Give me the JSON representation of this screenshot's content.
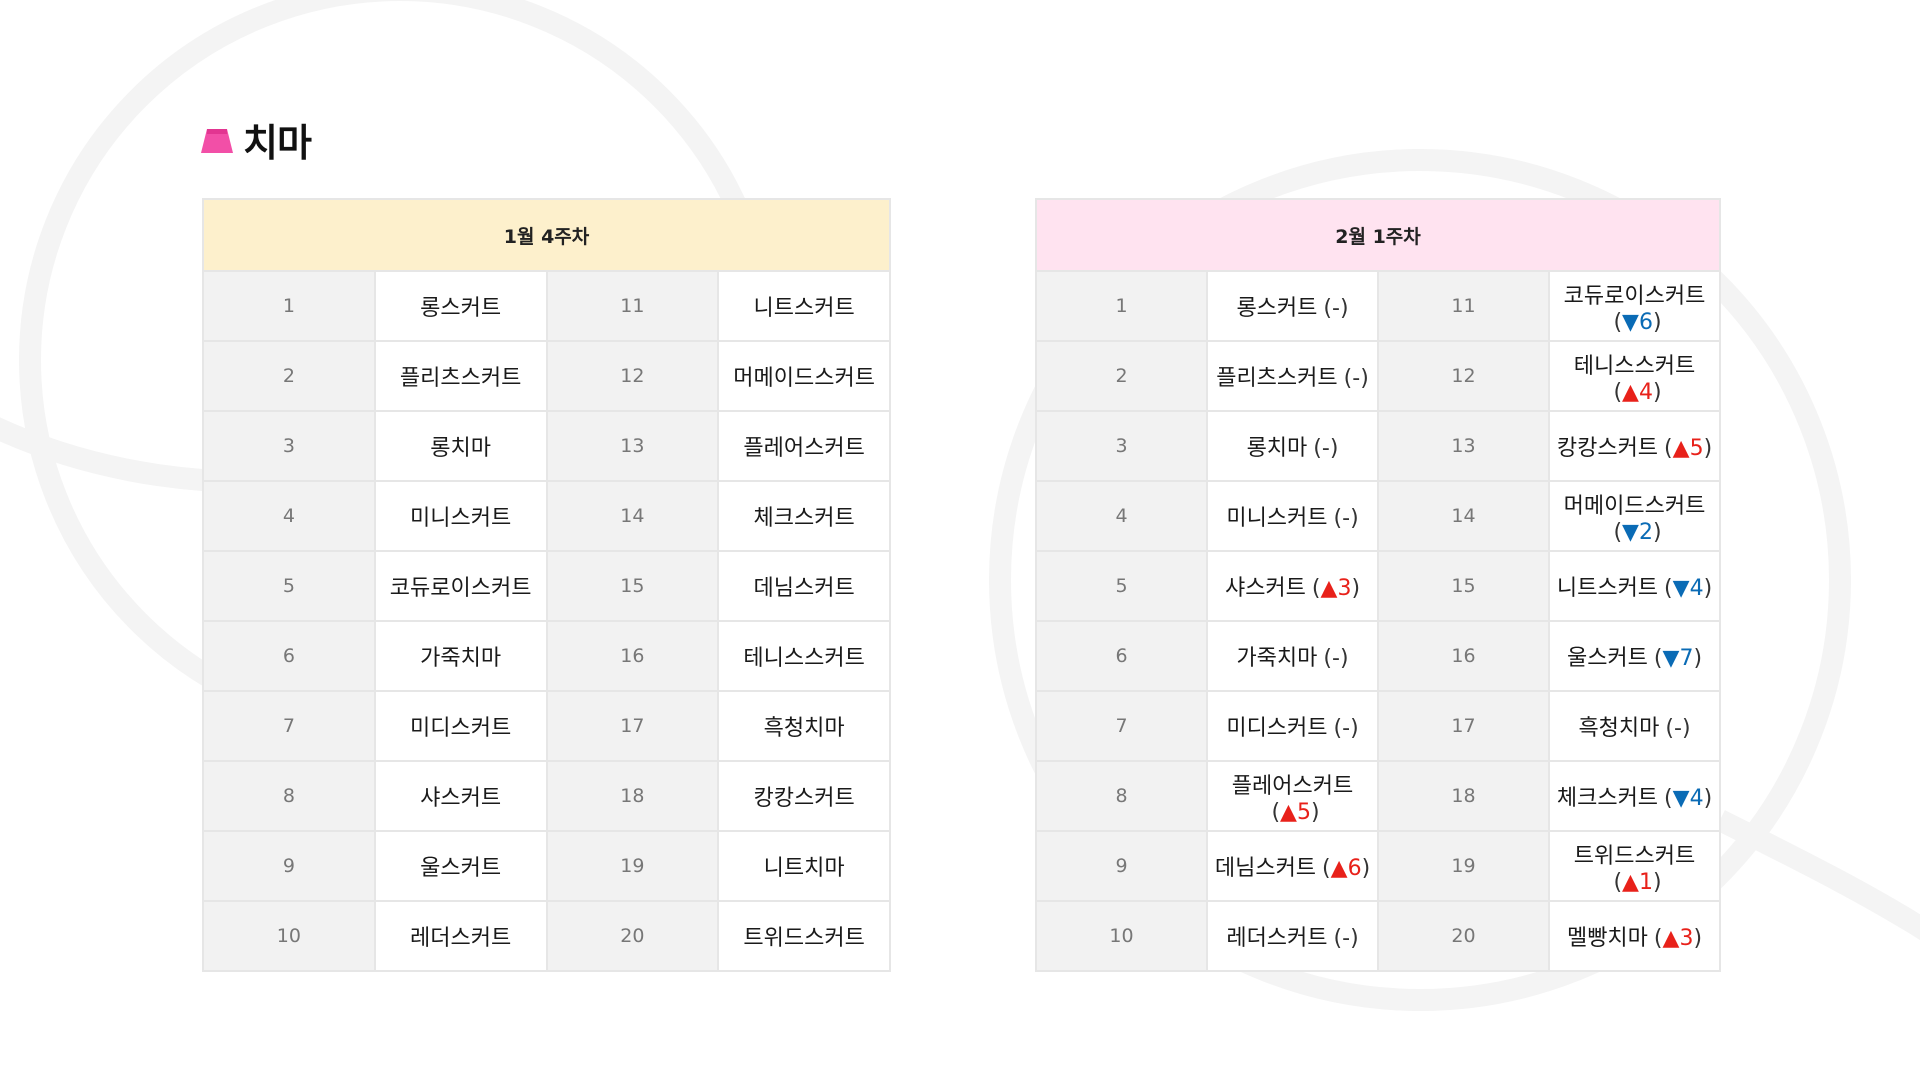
{
  "title": "치마",
  "colors": {
    "accent_pink": "#f24fa7",
    "header_left_bg": "#fdf0cc",
    "header_right_bg": "#ffe3f0",
    "up": "#e8211a",
    "down": "#0a6bb5"
  },
  "icon": "skirt-icon",
  "left_table": {
    "header": "1월 4주차",
    "rows": [
      {
        "rank_a": "1",
        "name_a": "롱스커트",
        "rank_b": "11",
        "name_b": "니트스커트"
      },
      {
        "rank_a": "2",
        "name_a": "플리츠스커트",
        "rank_b": "12",
        "name_b": "머메이드스커트"
      },
      {
        "rank_a": "3",
        "name_a": "롱치마",
        "rank_b": "13",
        "name_b": "플레어스커트"
      },
      {
        "rank_a": "4",
        "name_a": "미니스커트",
        "rank_b": "14",
        "name_b": "체크스커트"
      },
      {
        "rank_a": "5",
        "name_a": "코듀로이스커트",
        "rank_b": "15",
        "name_b": "데님스커트"
      },
      {
        "rank_a": "6",
        "name_a": "가죽치마",
        "rank_b": "16",
        "name_b": "테니스스커트"
      },
      {
        "rank_a": "7",
        "name_a": "미디스커트",
        "rank_b": "17",
        "name_b": "흑청치마"
      },
      {
        "rank_a": "8",
        "name_a": "샤스커트",
        "rank_b": "18",
        "name_b": "캉캉스커트"
      },
      {
        "rank_a": "9",
        "name_a": "울스커트",
        "rank_b": "19",
        "name_b": "니트치마"
      },
      {
        "rank_a": "10",
        "name_a": "레더스커트",
        "rank_b": "20",
        "name_b": "트위드스커트"
      }
    ]
  },
  "right_table": {
    "header": "2월 1주차",
    "rows": [
      {
        "rank_a": "1",
        "name_a": "롱스커트",
        "chg_a": {
          "dir": "none",
          "val": "-"
        },
        "rank_b": "11",
        "name_b": "코듀로이스커트",
        "chg_b": {
          "dir": "down",
          "val": "6"
        }
      },
      {
        "rank_a": "2",
        "name_a": "플리츠스커트",
        "chg_a": {
          "dir": "none",
          "val": "-"
        },
        "rank_b": "12",
        "name_b": "테니스스커트",
        "chg_b": {
          "dir": "up",
          "val": "4"
        }
      },
      {
        "rank_a": "3",
        "name_a": "롱치마",
        "chg_a": {
          "dir": "none",
          "val": "-"
        },
        "rank_b": "13",
        "name_b": "캉캉스커트",
        "chg_b": {
          "dir": "up",
          "val": "5"
        }
      },
      {
        "rank_a": "4",
        "name_a": "미니스커트",
        "chg_a": {
          "dir": "none",
          "val": "-"
        },
        "rank_b": "14",
        "name_b": "머메이드스커트",
        "chg_b": {
          "dir": "down",
          "val": "2"
        }
      },
      {
        "rank_a": "5",
        "name_a": "샤스커트",
        "chg_a": {
          "dir": "up",
          "val": "3"
        },
        "rank_b": "15",
        "name_b": "니트스커트",
        "chg_b": {
          "dir": "down",
          "val": "4"
        }
      },
      {
        "rank_a": "6",
        "name_a": "가죽치마",
        "chg_a": {
          "dir": "none",
          "val": "-"
        },
        "rank_b": "16",
        "name_b": "울스커트",
        "chg_b": {
          "dir": "down",
          "val": "7"
        }
      },
      {
        "rank_a": "7",
        "name_a": "미디스커트",
        "chg_a": {
          "dir": "none",
          "val": "-"
        },
        "rank_b": "17",
        "name_b": "흑청치마",
        "chg_b": {
          "dir": "none",
          "val": "-"
        }
      },
      {
        "rank_a": "8",
        "name_a": "플레어스커트",
        "chg_a": {
          "dir": "up",
          "val": "5"
        },
        "rank_b": "18",
        "name_b": "체크스커트",
        "chg_b": {
          "dir": "down",
          "val": "4"
        }
      },
      {
        "rank_a": "9",
        "name_a": "데님스커트",
        "chg_a": {
          "dir": "up",
          "val": "6"
        },
        "rank_b": "19",
        "name_b": "트위드스커트",
        "chg_b": {
          "dir": "up",
          "val": "1"
        }
      },
      {
        "rank_a": "10",
        "name_a": "레더스커트",
        "chg_a": {
          "dir": "none",
          "val": "-"
        },
        "rank_b": "20",
        "name_b": "멜빵치마",
        "chg_b": {
          "dir": "up",
          "val": "3"
        }
      }
    ]
  }
}
